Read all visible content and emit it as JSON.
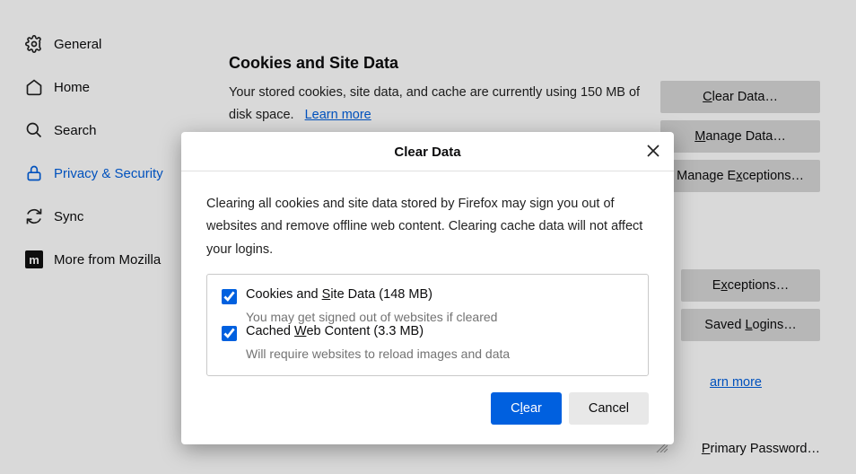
{
  "sidebar": {
    "items": [
      {
        "label": "General"
      },
      {
        "label": "Home"
      },
      {
        "label": "Search"
      },
      {
        "label": "Privacy & Security"
      },
      {
        "label": "Sync"
      },
      {
        "label": "More from Mozilla"
      }
    ]
  },
  "main": {
    "section_title": "Cookies and Site Data",
    "section_desc": "Your stored cookies, site data, and cache are currently using 150 MB of disk space.",
    "learn_more": "Learn more",
    "buttons": {
      "clear_data": "Clear Data…",
      "manage_data": "Manage Data…",
      "manage_exceptions": "Manage Exceptions…",
      "exceptions": "Exceptions…",
      "saved_logins": "Saved Logins…"
    },
    "learn2": "arn more",
    "primary_pw": "Primary Password…"
  },
  "dialog": {
    "title": "Clear Data",
    "body": "Clearing all cookies and site data stored by Firefox may sign you out of websites and remove offline web content. Clearing cache data will not affect your logins.",
    "opt1_label": "Cookies and Site Data (148 MB)",
    "opt1_desc": "You may get signed out of websites if cleared",
    "opt2_label": "Cached Web Content (3.3 MB)",
    "opt2_desc": "Will require websites to reload images and data",
    "clear": "Clear",
    "cancel": "Cancel"
  }
}
